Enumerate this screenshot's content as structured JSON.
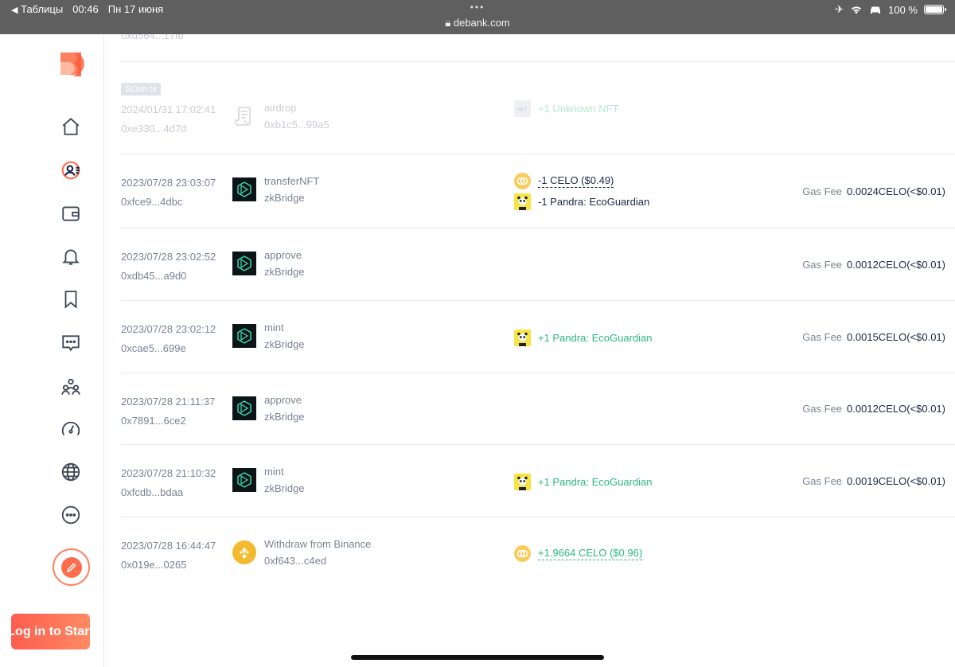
{
  "status_bar": {
    "back_app": "Таблицы",
    "time": "00:46",
    "date": "Пн 17 июня",
    "dots": "•••",
    "url": "debank.com",
    "battery": "100 %"
  },
  "sidebar": {
    "login_label": "Log in to Start",
    "icons": [
      "home-icon",
      "profile-icon",
      "wallet-icon",
      "bell-icon",
      "bookmark-icon",
      "chat-icon",
      "community-icon",
      "gauge-icon",
      "globe-icon",
      "more-icon"
    ],
    "accent": "#fe6e4e"
  },
  "cut_row_hash": "0xd564...17fb",
  "transactions": [
    {
      "scam": true,
      "badge": "Scam tx",
      "time": "2024/01/31 17:02:41",
      "hash": "0xe330...4d7d",
      "method": "airdrop",
      "app": "0xb1c5...99a5",
      "icon": "scroll-icon",
      "tokens": [
        {
          "text": "+1 Unknown NFT",
          "dir": "pos",
          "icon": "nft-icon",
          "dotted": false
        }
      ],
      "gas_label": "",
      "gas_value": ""
    },
    {
      "scam": false,
      "time": "2023/07/28 23:03:07",
      "hash": "0xfce9...4dbc",
      "method": "transferNFT",
      "app": "zkBridge",
      "icon": "zkbridge-icon",
      "tokens": [
        {
          "text": "-1 CELO ($0.49)",
          "dir": "neg",
          "icon": "celo-icon",
          "dotted": true
        },
        {
          "text": "-1 Pandra: EcoGuardian",
          "dir": "neg",
          "icon": "pandra-icon",
          "dotted": false
        }
      ],
      "gas_label": "Gas Fee",
      "gas_value": "0.0024CELO(<$0.01)"
    },
    {
      "scam": false,
      "time": "2023/07/28 23:02:52",
      "hash": "0xdb45...a9d0",
      "method": "approve",
      "app": "zkBridge",
      "icon": "zkbridge-icon",
      "tokens": [],
      "gas_label": "Gas Fee",
      "gas_value": "0.0012CELO(<$0.01)"
    },
    {
      "scam": false,
      "time": "2023/07/28 23:02:12",
      "hash": "0xcae5...699e",
      "method": "mint",
      "app": "zkBridge",
      "icon": "zkbridge-icon",
      "tokens": [
        {
          "text": "+1 Pandra: EcoGuardian",
          "dir": "pos",
          "icon": "pandra-icon",
          "dotted": false
        }
      ],
      "gas_label": "Gas Fee",
      "gas_value": "0.0015CELO(<$0.01)"
    },
    {
      "scam": false,
      "time": "2023/07/28 21:11:37",
      "hash": "0x7891...6ce2",
      "method": "approve",
      "app": "zkBridge",
      "icon": "zkbridge-icon",
      "tokens": [],
      "gas_label": "Gas Fee",
      "gas_value": "0.0012CELO(<$0.01)"
    },
    {
      "scam": false,
      "time": "2023/07/28 21:10:32",
      "hash": "0xfcdb...bdaa",
      "method": "mint",
      "app": "zkBridge",
      "icon": "zkbridge-icon",
      "tokens": [
        {
          "text": "+1 Pandra: EcoGuardian",
          "dir": "pos",
          "icon": "pandra-icon",
          "dotted": false
        }
      ],
      "gas_label": "Gas Fee",
      "gas_value": "0.0019CELO(<$0.01)"
    },
    {
      "scam": false,
      "time": "2023/07/28 16:44:47",
      "hash": "0x019e...0265",
      "method": "Withdraw from Binance",
      "app": "0xf643...c4ed",
      "icon": "binance-icon",
      "tokens": [
        {
          "text": "+1.9664 CELO ($0.96)",
          "dir": "pos",
          "icon": "celo-icon",
          "dotted": true
        }
      ],
      "gas_label": "",
      "gas_value": ""
    }
  ]
}
